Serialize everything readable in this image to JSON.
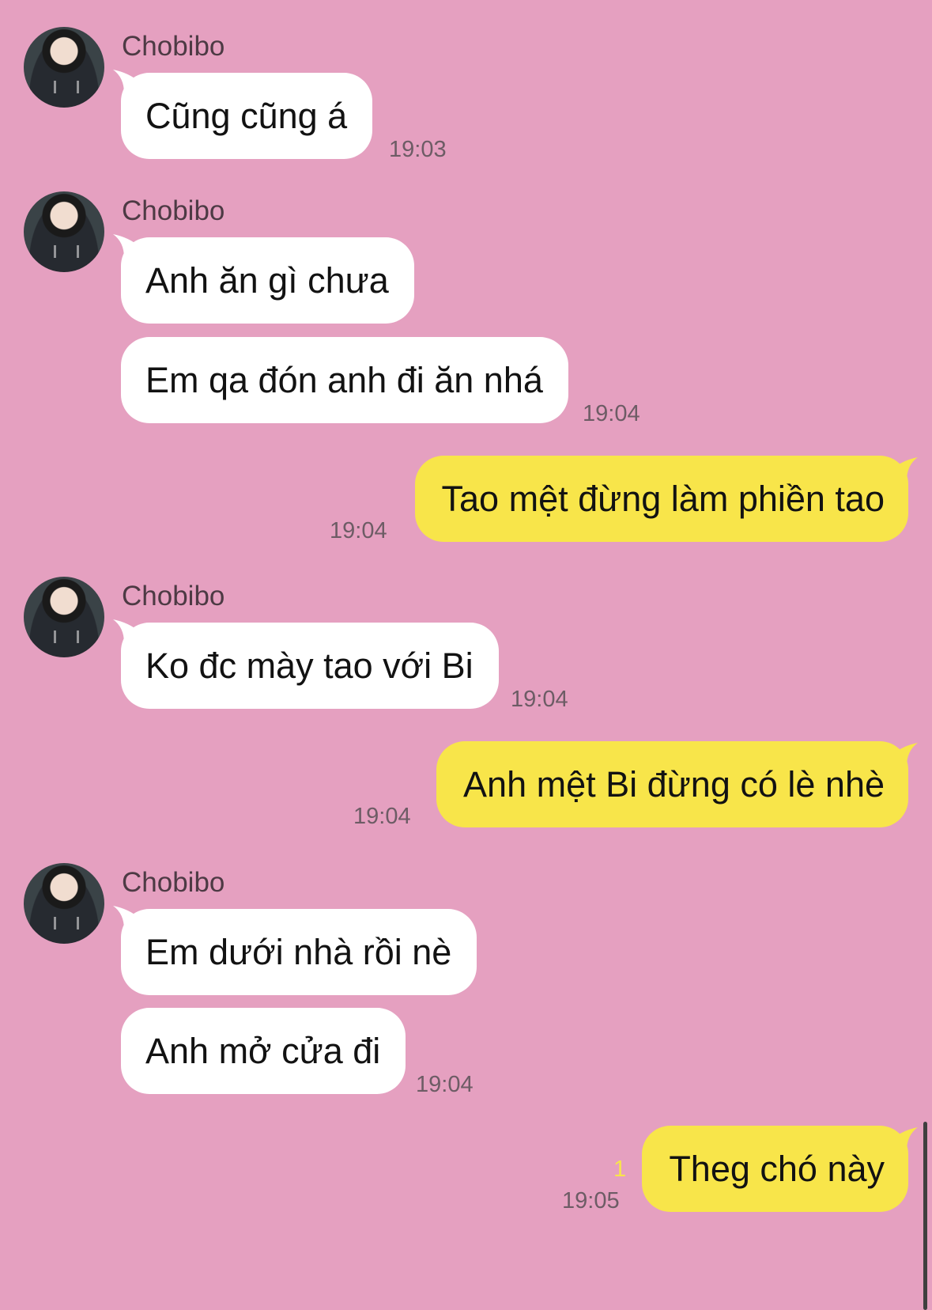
{
  "chat": {
    "contact_name": "Chobibo",
    "groups": [
      {
        "name": "Chobibo",
        "messages": [
          "Cũng cũng á"
        ],
        "time": "19:03"
      },
      {
        "name": "Chobibo",
        "messages": [
          "Anh ăn gì chưa",
          "Em qa đón anh đi ăn nhá"
        ],
        "time": "19:04"
      },
      {
        "outgoing": true,
        "message": "Tao mệt đừng làm phiền tao",
        "time": "19:04"
      },
      {
        "name": "Chobibo",
        "messages": [
          "Ko đc mày tao với Bi"
        ],
        "time": "19:04"
      },
      {
        "outgoing": true,
        "message": "Anh mệt Bi đừng có lè nhè",
        "time": "19:04"
      },
      {
        "name": "Chobibo",
        "messages": [
          "Em dưới nhà rồi nè",
          "Anh mở cửa đi"
        ],
        "time": "19:04"
      },
      {
        "outgoing": true,
        "message": "Theg chó này",
        "time": "19:05",
        "unread_count": "1"
      }
    ]
  },
  "colors": {
    "background": "#e5a0c0",
    "incoming_bubble": "#ffffff",
    "outgoing_bubble": "#f8e54a"
  }
}
